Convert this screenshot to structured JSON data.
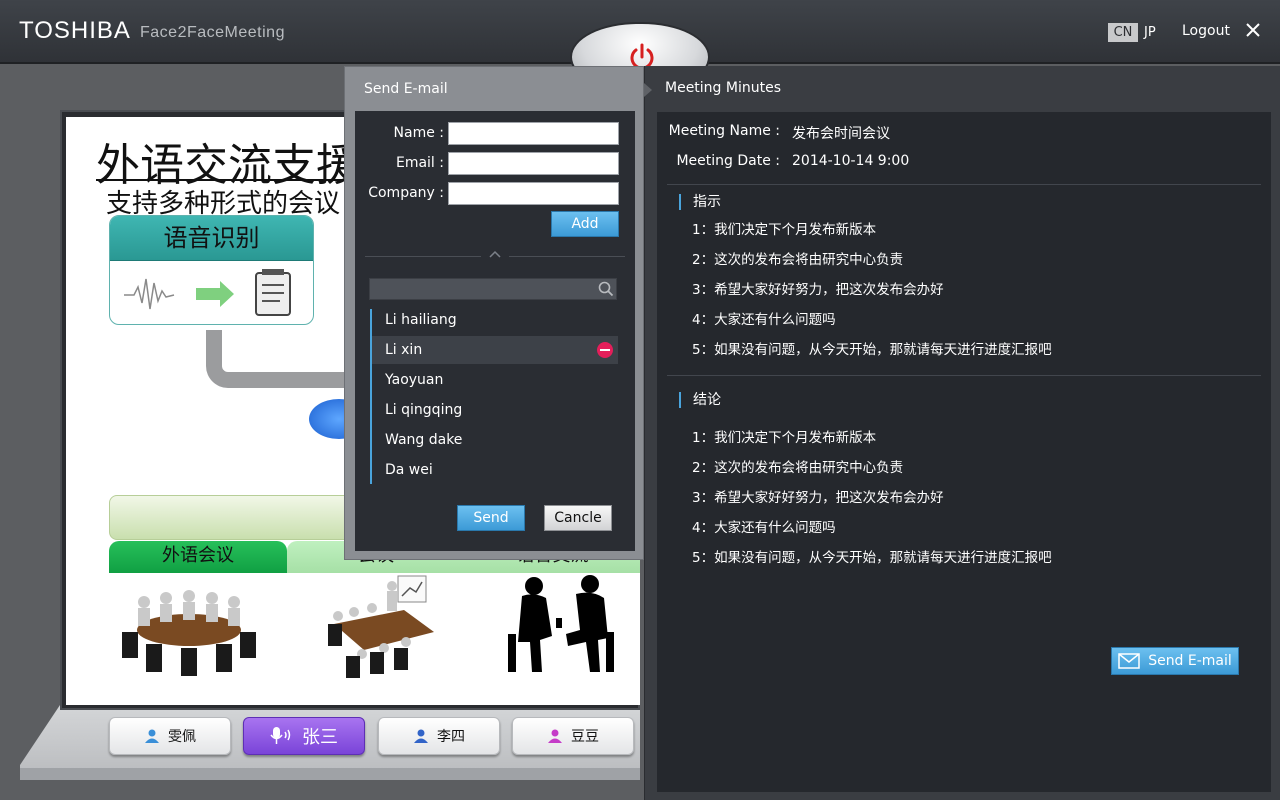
{
  "header": {
    "brand": "TOSHIBA",
    "app_name": "Face2FaceMeeting",
    "lang_cn": "CN",
    "lang_jp": "JP",
    "logout": "Logout"
  },
  "slide": {
    "title": "外语交流支援",
    "subtitle": "支持多种形式的会议",
    "speech_box": "语音识别",
    "tabs": [
      "外语会议",
      "会议",
      "语音交流"
    ]
  },
  "users": [
    {
      "name": "雯佩",
      "icon_color": "#3a8fd8",
      "active": false
    },
    {
      "name": "张三",
      "icon_color": "#ffffff",
      "active": true
    },
    {
      "name": "李四",
      "icon_color": "#3264c8",
      "active": false
    },
    {
      "name": "豆豆",
      "icon_color": "#c53cc8",
      "active": false
    }
  ],
  "send_email": {
    "title": "Send E-mail",
    "name_label": "Name :",
    "email_label": "Email :",
    "company_label": "Company :",
    "name_value": "",
    "email_value": "",
    "company_value": "",
    "add_label": "Add",
    "search_placeholder": "",
    "contacts": [
      "Li hailiang",
      "Li xin",
      "Yaoyuan",
      "Li qingqing",
      "Wang dake",
      "Da wei"
    ],
    "selected_contact": "Li xin",
    "send_label": "Send",
    "cancel_label": "Cancle"
  },
  "minutes": {
    "title": "Meeting Minutes",
    "name_label": "Meeting Name :",
    "name_value": "发布会时间会议",
    "date_label": "Meeting Date :",
    "date_value": "2014-10-14 9:00",
    "section1": {
      "heading": "指示",
      "items": [
        "1：我们决定下个月发布新版本",
        "2：这次的发布会将由研究中心负责",
        "3：希望大家好好努力，把这次发布会办好",
        "4：大家还有什么问题吗",
        "5：如果没有问题，从今天开始，那就请每天进行进度汇报吧"
      ]
    },
    "section2": {
      "heading": "结论",
      "items": [
        "1：我们决定下个月发布新版本",
        "2：这次的发布会将由研究中心负责",
        "3：希望大家好好努力，把这次发布会办好",
        "4：大家还有什么问题吗",
        "5：如果没有问题，从今天开始，那就请每天进行进度汇报吧"
      ]
    },
    "send_email_label": "Send E-mail"
  },
  "colors": {
    "accent_blue": "#4aa4dc",
    "active_user": "#8a55e0",
    "remove_red": "#e41e5a",
    "power_red": "#d62020"
  },
  "icons": [
    "power-icon",
    "close-icon",
    "search-icon",
    "remove-icon",
    "envelope-icon",
    "microphone-icon",
    "user-icon",
    "caret-up-icon"
  ]
}
